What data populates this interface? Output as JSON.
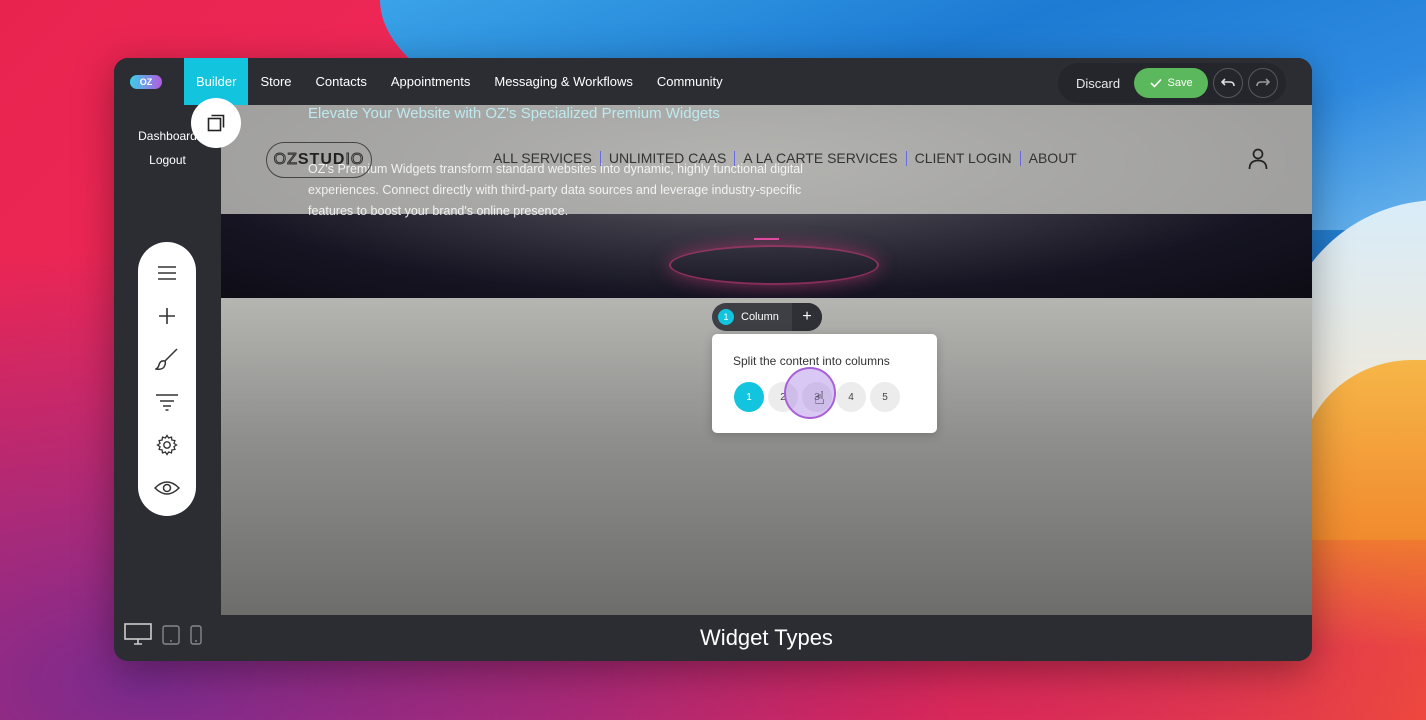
{
  "app": {
    "logo_text": "OZ",
    "nav": [
      "Builder",
      "Store",
      "Contacts",
      "Appointments",
      "Messaging & Workflows",
      "Community"
    ],
    "active_nav": "Builder",
    "discard_label": "Discard",
    "save_label": "Save"
  },
  "sidebar": {
    "links": [
      "Dashboard",
      "Logout"
    ],
    "tools": [
      "menu-icon",
      "plus-icon",
      "brush-icon",
      "filter-icon",
      "gear-icon",
      "eye-icon"
    ],
    "devices": [
      "desktop-icon",
      "tablet-icon",
      "mobile-icon"
    ]
  },
  "site": {
    "brand_outline": "OZ",
    "brand_bold": "STUD",
    "brand_end": "IO",
    "nav": [
      "ALL SERVICES",
      "UNLIMITED CAAS",
      "A LA CARTE SERVICES",
      "CLIENT LOGIN",
      "ABOUT"
    ],
    "hero_title": "Elevate Your Website with OZ's Specialized Premium Widgets",
    "hero_desc": "OZ's Premium Widgets transform standard websites into dynamic, highly functional digital experiences. Connect directly with third-party data sources and leverage industry-specific features to boost your brand's online presence."
  },
  "column_toolbar": {
    "count": "1",
    "label": "Column",
    "add": "+"
  },
  "split_popover": {
    "title": "Split the content into columns",
    "options": [
      "1",
      "2",
      "3",
      "4",
      "5"
    ],
    "selected": "1"
  },
  "footer_heading": "Widget Types",
  "colors": {
    "accent": "#12c4dd",
    "save": "#5cb85c",
    "chrome": "#2b2d33"
  }
}
